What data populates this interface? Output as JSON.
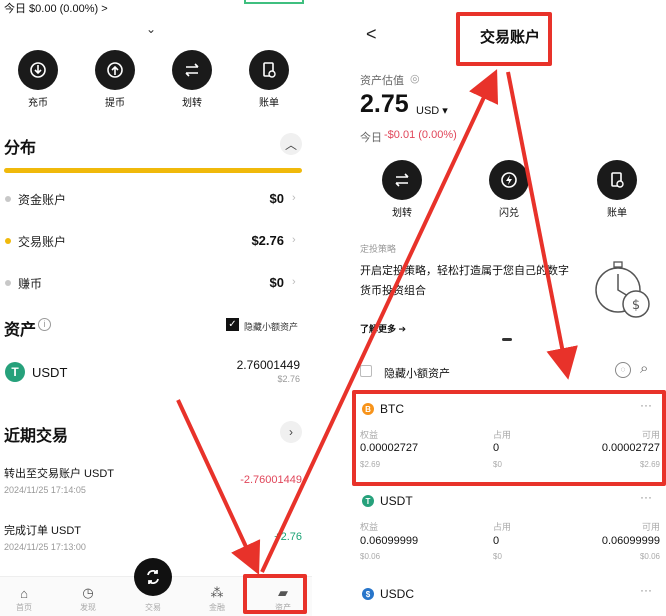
{
  "left": {
    "today_line": "今日 $0.00 (0.00%) >",
    "actions": [
      {
        "label": "充币",
        "icon": "deposit-icon"
      },
      {
        "label": "提币",
        "icon": "withdraw-icon"
      },
      {
        "label": "划转",
        "icon": "transfer-icon"
      },
      {
        "label": "账单",
        "icon": "bill-icon"
      }
    ],
    "distribution": {
      "title": "分布",
      "rows": [
        {
          "label": "资金账户",
          "value": "$0",
          "color": "#c8c8c8"
        },
        {
          "label": "交易账户",
          "value": "$2.76",
          "color": "#f0b90b"
        },
        {
          "label": "赚币",
          "value": "$0",
          "color": "#c8c8c8"
        }
      ]
    },
    "assets": {
      "title": "资产",
      "hide_small_label": "隐藏小额资产",
      "items": [
        {
          "symbol": "USDT",
          "amount": "2.76001449",
          "usd": "$2.76"
        }
      ]
    },
    "recent": {
      "title": "近期交易",
      "items": [
        {
          "title": "转出至交易账户 USDT",
          "time": "2024/11/25 17:14:05",
          "amount": "-2.76001449",
          "color": "#e0465a"
        },
        {
          "title": "完成订单 USDT",
          "time": "2024/11/25 17:13:00",
          "amount": "+2.76",
          "color": "#1aa375"
        }
      ]
    },
    "tabs": [
      {
        "label": "首页",
        "icon": "home-icon"
      },
      {
        "label": "发现",
        "icon": "discover-icon"
      },
      {
        "label": "交易",
        "icon": "trade-icon"
      },
      {
        "label": "金融",
        "icon": "finance-icon"
      },
      {
        "label": "资产",
        "icon": "wallet-icon"
      }
    ]
  },
  "right": {
    "back": "<",
    "title": "交易账户",
    "est_label": "资产估值",
    "balance": "2.75",
    "currency": "USD ▾",
    "today_prefix": "今日",
    "today_change": "-$0.01 (0.00%)",
    "actions": [
      {
        "label": "划转",
        "icon": "transfer-icon"
      },
      {
        "label": "闪兑",
        "icon": "flash-swap-icon"
      },
      {
        "label": "账单",
        "icon": "bill-icon"
      }
    ],
    "promo": {
      "tag": "定投策略",
      "line1": "开启定投策略，轻松打造属于您自己的数字",
      "line2": "货币投资组合",
      "link": "了解更多 ➔"
    },
    "hide_small_label": "隐藏小额资产",
    "columns": [
      "权益",
      "占用",
      "可用"
    ],
    "assets": [
      {
        "symbol": "BTC",
        "color": "#f7931a",
        "letter": "B",
        "equity": "0.00002727",
        "equity_usd": "$2.69",
        "used": "0",
        "used_usd": "$0",
        "avail": "0.00002727",
        "avail_usd": "$2.69"
      },
      {
        "symbol": "USDT",
        "color": "#26a17b",
        "letter": "T",
        "equity": "0.06099999",
        "equity_usd": "$0.06",
        "used": "0",
        "used_usd": "$0",
        "avail": "0.06099999",
        "avail_usd": "$0.06"
      },
      {
        "symbol": "USDC",
        "color": "#2775ca",
        "letter": "$"
      }
    ]
  }
}
